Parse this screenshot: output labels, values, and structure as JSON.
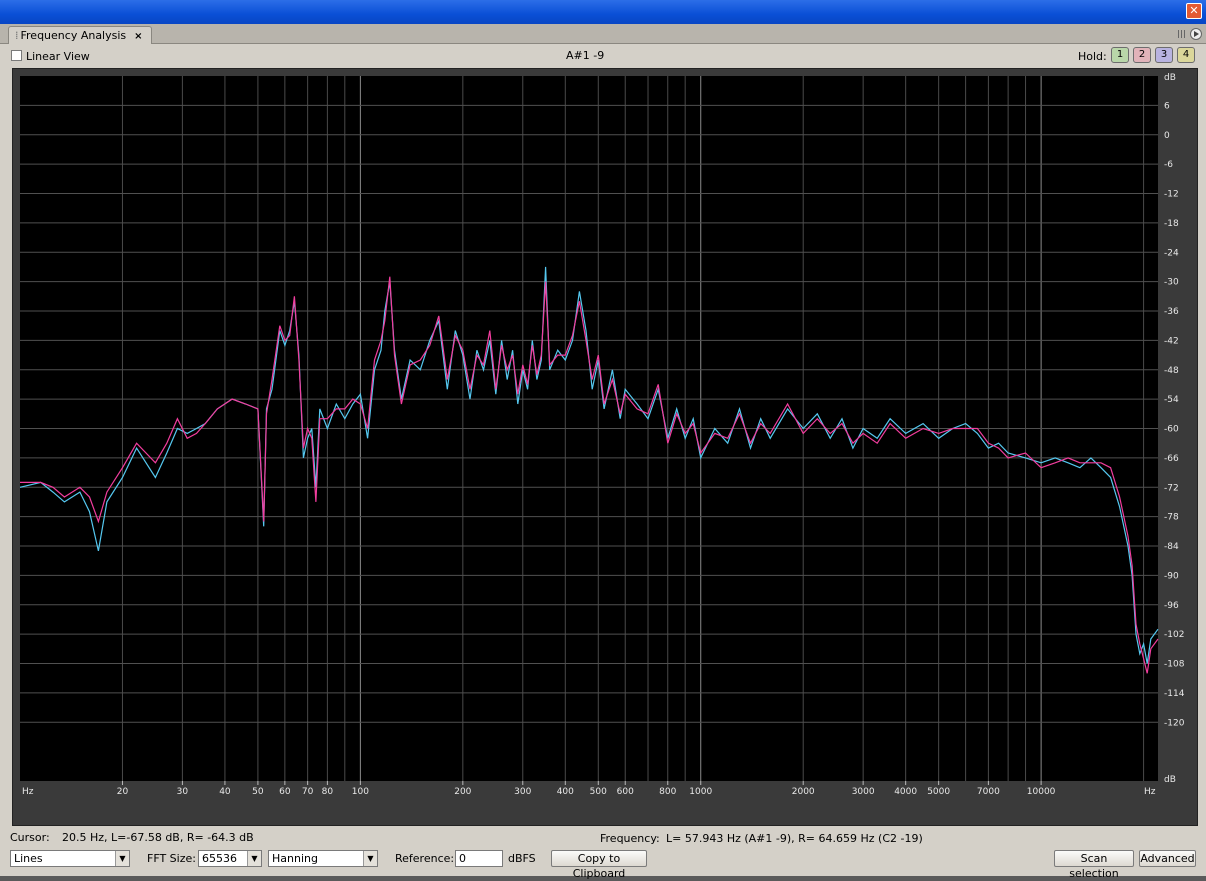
{
  "window": {
    "close_glyph": "✕"
  },
  "tab": {
    "title": "Frequency Analysis",
    "close_glyph": "×"
  },
  "view": {
    "linear_view_label": "Linear View",
    "note_display": "A#1 -9"
  },
  "hold": {
    "label": "Hold:",
    "buttons": [
      {
        "label": "1",
        "color": "#b9d7a9"
      },
      {
        "label": "2",
        "color": "#e1b3b9"
      },
      {
        "label": "3",
        "color": "#b8b3e0"
      },
      {
        "label": "4",
        "color": "#dbd79a"
      }
    ]
  },
  "chart_data": {
    "type": "line",
    "x_scale": "log",
    "xlim": [
      10,
      22050
    ],
    "ylim": [
      -132,
      12
    ],
    "x_unit_label": "Hz",
    "y_unit_label": "dB",
    "x_ticks": [
      {
        "v": 20,
        "label": "20"
      },
      {
        "v": 30,
        "label": "30"
      },
      {
        "v": 40,
        "label": "40"
      },
      {
        "v": 50,
        "label": "50"
      },
      {
        "v": 60,
        "label": "60"
      },
      {
        "v": 70,
        "label": "70"
      },
      {
        "v": 80,
        "label": "80"
      },
      {
        "v": 100,
        "label": "100"
      },
      {
        "v": 200,
        "label": "200"
      },
      {
        "v": 300,
        "label": "300"
      },
      {
        "v": 400,
        "label": "400"
      },
      {
        "v": 500,
        "label": "500"
      },
      {
        "v": 600,
        "label": "600"
      },
      {
        "v": 800,
        "label": "800"
      },
      {
        "v": 1000,
        "label": "1000"
      },
      {
        "v": 2000,
        "label": "2000"
      },
      {
        "v": 3000,
        "label": "3000"
      },
      {
        "v": 4000,
        "label": "4000"
      },
      {
        "v": 5000,
        "label": "5000"
      },
      {
        "v": 7000,
        "label": "7000"
      },
      {
        "v": 10000,
        "label": "10000"
      }
    ],
    "y_ticks": [
      6,
      0,
      -6,
      -12,
      -18,
      -24,
      -30,
      -36,
      -42,
      -48,
      -54,
      -60,
      -66,
      -72,
      -78,
      -84,
      -90,
      -96,
      -102,
      -108,
      -114,
      -120
    ],
    "grid": true,
    "series": [
      {
        "color": "#55c8f0",
        "points": [
          [
            10,
            -72
          ],
          [
            11.5,
            -71
          ],
          [
            12.5,
            -73
          ],
          [
            13.5,
            -75
          ],
          [
            15,
            -73
          ],
          [
            16,
            -77
          ],
          [
            17,
            -85
          ],
          [
            18,
            -75
          ],
          [
            20,
            -70
          ],
          [
            22,
            -64
          ],
          [
            25,
            -70
          ],
          [
            27,
            -65
          ],
          [
            29,
            -60
          ],
          [
            31,
            -61
          ],
          [
            33,
            -60
          ],
          [
            35,
            -59
          ],
          [
            38,
            -56
          ],
          [
            42,
            -54
          ],
          [
            46,
            -55
          ],
          [
            50,
            -56
          ],
          [
            52,
            -80
          ],
          [
            53,
            -56
          ],
          [
            55,
            -52
          ],
          [
            58,
            -40
          ],
          [
            60,
            -43
          ],
          [
            62,
            -40
          ],
          [
            64,
            -34
          ],
          [
            66,
            -45
          ],
          [
            68,
            -66
          ],
          [
            70,
            -62
          ],
          [
            72,
            -60
          ],
          [
            74,
            -72
          ],
          [
            76,
            -56
          ],
          [
            80,
            -60
          ],
          [
            85,
            -55
          ],
          [
            90,
            -58
          ],
          [
            95,
            -55
          ],
          [
            100,
            -53
          ],
          [
            105,
            -62
          ],
          [
            110,
            -48
          ],
          [
            115,
            -44
          ],
          [
            118,
            -36
          ],
          [
            122,
            -30
          ],
          [
            126,
            -44
          ],
          [
            132,
            -54
          ],
          [
            140,
            -46
          ],
          [
            150,
            -48
          ],
          [
            160,
            -42
          ],
          [
            170,
            -38
          ],
          [
            180,
            -52
          ],
          [
            190,
            -40
          ],
          [
            200,
            -45
          ],
          [
            210,
            -54
          ],
          [
            220,
            -44
          ],
          [
            230,
            -48
          ],
          [
            240,
            -42
          ],
          [
            250,
            -53
          ],
          [
            260,
            -42
          ],
          [
            270,
            -50
          ],
          [
            280,
            -44
          ],
          [
            290,
            -55
          ],
          [
            300,
            -48
          ],
          [
            310,
            -52
          ],
          [
            320,
            -42
          ],
          [
            330,
            -50
          ],
          [
            340,
            -46
          ],
          [
            350,
            -27
          ],
          [
            360,
            -48
          ],
          [
            380,
            -44
          ],
          [
            400,
            -46
          ],
          [
            420,
            -42
          ],
          [
            440,
            -32
          ],
          [
            460,
            -40
          ],
          [
            480,
            -52
          ],
          [
            500,
            -46
          ],
          [
            520,
            -56
          ],
          [
            550,
            -48
          ],
          [
            580,
            -58
          ],
          [
            600,
            -52
          ],
          [
            650,
            -55
          ],
          [
            700,
            -58
          ],
          [
            750,
            -52
          ],
          [
            800,
            -62
          ],
          [
            850,
            -56
          ],
          [
            900,
            -62
          ],
          [
            950,
            -58
          ],
          [
            1000,
            -66
          ],
          [
            1100,
            -60
          ],
          [
            1200,
            -63
          ],
          [
            1300,
            -56
          ],
          [
            1400,
            -64
          ],
          [
            1500,
            -58
          ],
          [
            1600,
            -62
          ],
          [
            1800,
            -56
          ],
          [
            2000,
            -60
          ],
          [
            2200,
            -57
          ],
          [
            2400,
            -62
          ],
          [
            2600,
            -58
          ],
          [
            2800,
            -64
          ],
          [
            3000,
            -60
          ],
          [
            3300,
            -62
          ],
          [
            3600,
            -58
          ],
          [
            4000,
            -61
          ],
          [
            4500,
            -59
          ],
          [
            5000,
            -62
          ],
          [
            5500,
            -60
          ],
          [
            6000,
            -59
          ],
          [
            6500,
            -61
          ],
          [
            7000,
            -64
          ],
          [
            7500,
            -63
          ],
          [
            8000,
            -65
          ],
          [
            9000,
            -66
          ],
          [
            10000,
            -67
          ],
          [
            11000,
            -66
          ],
          [
            12000,
            -67
          ],
          [
            13000,
            -68
          ],
          [
            14000,
            -66
          ],
          [
            15000,
            -68
          ],
          [
            16000,
            -70
          ],
          [
            17000,
            -76
          ],
          [
            18000,
            -84
          ],
          [
            18500,
            -90
          ],
          [
            19000,
            -102
          ],
          [
            19500,
            -106
          ],
          [
            20000,
            -104
          ],
          [
            20500,
            -108
          ],
          [
            21000,
            -103
          ],
          [
            22050,
            -101
          ]
        ]
      },
      {
        "color": "#f23d9e",
        "points": [
          [
            10,
            -71
          ],
          [
            11.5,
            -71
          ],
          [
            12.5,
            -72
          ],
          [
            13.5,
            -74
          ],
          [
            15,
            -72
          ],
          [
            16,
            -74
          ],
          [
            17,
            -79
          ],
          [
            18,
            -73
          ],
          [
            20,
            -68
          ],
          [
            22,
            -63
          ],
          [
            25,
            -67
          ],
          [
            27,
            -63
          ],
          [
            29,
            -58
          ],
          [
            31,
            -62
          ],
          [
            33,
            -61
          ],
          [
            35,
            -59
          ],
          [
            38,
            -56
          ],
          [
            42,
            -54
          ],
          [
            46,
            -55
          ],
          [
            50,
            -56
          ],
          [
            52,
            -79
          ],
          [
            53,
            -57
          ],
          [
            55,
            -50
          ],
          [
            58,
            -39
          ],
          [
            60,
            -42
          ],
          [
            62,
            -41
          ],
          [
            64,
            -33
          ],
          [
            66,
            -46
          ],
          [
            68,
            -64
          ],
          [
            70,
            -60
          ],
          [
            72,
            -62
          ],
          [
            74,
            -75
          ],
          [
            76,
            -58
          ],
          [
            80,
            -58
          ],
          [
            85,
            -56
          ],
          [
            90,
            -56
          ],
          [
            95,
            -54
          ],
          [
            100,
            -55
          ],
          [
            105,
            -60
          ],
          [
            110,
            -46
          ],
          [
            115,
            -42
          ],
          [
            118,
            -38
          ],
          [
            122,
            -29
          ],
          [
            126,
            -45
          ],
          [
            132,
            -55
          ],
          [
            140,
            -47
          ],
          [
            150,
            -46
          ],
          [
            160,
            -43
          ],
          [
            170,
            -37
          ],
          [
            180,
            -50
          ],
          [
            190,
            -41
          ],
          [
            200,
            -44
          ],
          [
            210,
            -52
          ],
          [
            220,
            -45
          ],
          [
            230,
            -47
          ],
          [
            240,
            -40
          ],
          [
            250,
            -52
          ],
          [
            260,
            -43
          ],
          [
            270,
            -48
          ],
          [
            280,
            -45
          ],
          [
            290,
            -53
          ],
          [
            300,
            -47
          ],
          [
            310,
            -51
          ],
          [
            320,
            -43
          ],
          [
            330,
            -49
          ],
          [
            340,
            -45
          ],
          [
            350,
            -30
          ],
          [
            360,
            -47
          ],
          [
            380,
            -45
          ],
          [
            400,
            -45
          ],
          [
            420,
            -41
          ],
          [
            440,
            -34
          ],
          [
            460,
            -42
          ],
          [
            480,
            -50
          ],
          [
            500,
            -45
          ],
          [
            520,
            -55
          ],
          [
            550,
            -50
          ],
          [
            580,
            -57
          ],
          [
            600,
            -53
          ],
          [
            650,
            -56
          ],
          [
            700,
            -57
          ],
          [
            750,
            -51
          ],
          [
            800,
            -63
          ],
          [
            850,
            -57
          ],
          [
            900,
            -61
          ],
          [
            950,
            -59
          ],
          [
            1000,
            -65
          ],
          [
            1100,
            -61
          ],
          [
            1200,
            -62
          ],
          [
            1300,
            -57
          ],
          [
            1400,
            -63
          ],
          [
            1500,
            -59
          ],
          [
            1600,
            -61
          ],
          [
            1800,
            -55
          ],
          [
            2000,
            -61
          ],
          [
            2200,
            -58
          ],
          [
            2400,
            -61
          ],
          [
            2600,
            -59
          ],
          [
            2800,
            -63
          ],
          [
            3000,
            -61
          ],
          [
            3300,
            -63
          ],
          [
            3600,
            -59
          ],
          [
            4000,
            -62
          ],
          [
            4500,
            -60
          ],
          [
            5000,
            -61
          ],
          [
            5500,
            -60
          ],
          [
            6000,
            -60
          ],
          [
            6500,
            -60
          ],
          [
            7000,
            -63
          ],
          [
            7500,
            -64
          ],
          [
            8000,
            -66
          ],
          [
            9000,
            -65
          ],
          [
            10000,
            -68
          ],
          [
            11000,
            -67
          ],
          [
            12000,
            -66
          ],
          [
            13000,
            -67
          ],
          [
            14000,
            -67
          ],
          [
            15000,
            -67
          ],
          [
            16000,
            -68
          ],
          [
            17000,
            -74
          ],
          [
            18000,
            -82
          ],
          [
            18500,
            -88
          ],
          [
            19000,
            -100
          ],
          [
            19500,
            -104
          ],
          [
            20000,
            -107
          ],
          [
            20500,
            -110
          ],
          [
            21000,
            -105
          ],
          [
            22050,
            -103
          ]
        ]
      }
    ]
  },
  "status": {
    "cursor_label": "Cursor:",
    "cursor_value": "20.5 Hz, L=-67.58 dB, R= -64.3 dB",
    "frequency_label": "Frequency:",
    "frequency_value": "L= 57.943 Hz (A#1 -9), R= 64.659 Hz (C2 -19)"
  },
  "controls": {
    "display_mode": "Lines",
    "fft_label": "FFT Size:",
    "fft_value": "65536",
    "window_value": "Hanning",
    "reference_label": "Reference:",
    "reference_value": "0",
    "reference_unit": "dBFS",
    "copy_label": "Copy to Clipboard",
    "scan_label": "Scan selection",
    "advanced_label": "Advanced"
  }
}
